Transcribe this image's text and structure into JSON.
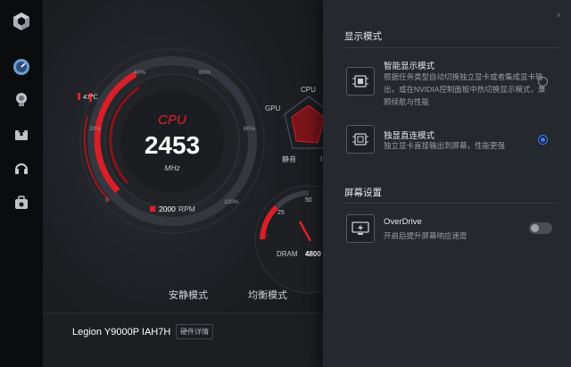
{
  "sidebar": {
    "logo_icon": "cube-logo-icon",
    "items": [
      {
        "icon": "dashboard-gauge-icon",
        "active": true
      },
      {
        "icon": "lightbulb-icon",
        "active": false
      },
      {
        "icon": "upload-icon",
        "active": false
      },
      {
        "icon": "headset-icon",
        "active": false
      },
      {
        "icon": "toolbox-icon",
        "active": false
      }
    ]
  },
  "dashboard": {
    "cpu_label": "CPU",
    "cpu_value": "2453",
    "cpu_unit": "MHz",
    "temperature": "47℃",
    "fan_speed": "2000",
    "fan_unit": "RPM",
    "gauge_ticks": [
      "0",
      "20%",
      "40%",
      "60%",
      "80%",
      "100%"
    ],
    "radar_labels": {
      "gpu": "GPU",
      "cpu": "CPU",
      "quiet": "静音",
      "cut": "I"
    },
    "dram_label": "DRAM",
    "dram_value": "4800",
    "dram_ticks": [
      "0",
      "25",
      "50"
    ]
  },
  "modes": {
    "quiet": "安静模式",
    "balanced": "均衡模式"
  },
  "device": {
    "model": "Legion Y9000P IAH7H",
    "hardware_details_label": "硬件详情"
  },
  "panel": {
    "chevron": "›",
    "display_mode_title": "显示模式",
    "options": [
      {
        "title": "智能显示模式",
        "desc": "根据任务类型自动切换独立显卡或者集成显卡输出，或在NVIDIA控制面板中热切换显示模式，兼顾续航与性能",
        "selected": false,
        "icon": "smart-display-chip-icon"
      },
      {
        "title": "独显直连模式",
        "desc": "独立显卡直接输出到屏幕，性能更强",
        "selected": true,
        "icon": "discrete-gpu-chip-icon"
      }
    ],
    "screen_settings_title": "屏幕设置",
    "overdrive": {
      "title": "OverDrive",
      "desc": "开启后提升屏幕响应速度",
      "enabled": false,
      "icon": "monitor-overdrive-icon"
    }
  },
  "colors": {
    "accent_red": "#e0202a",
    "radio_blue": "#3d7bff",
    "panel_bg": "#25282d"
  }
}
